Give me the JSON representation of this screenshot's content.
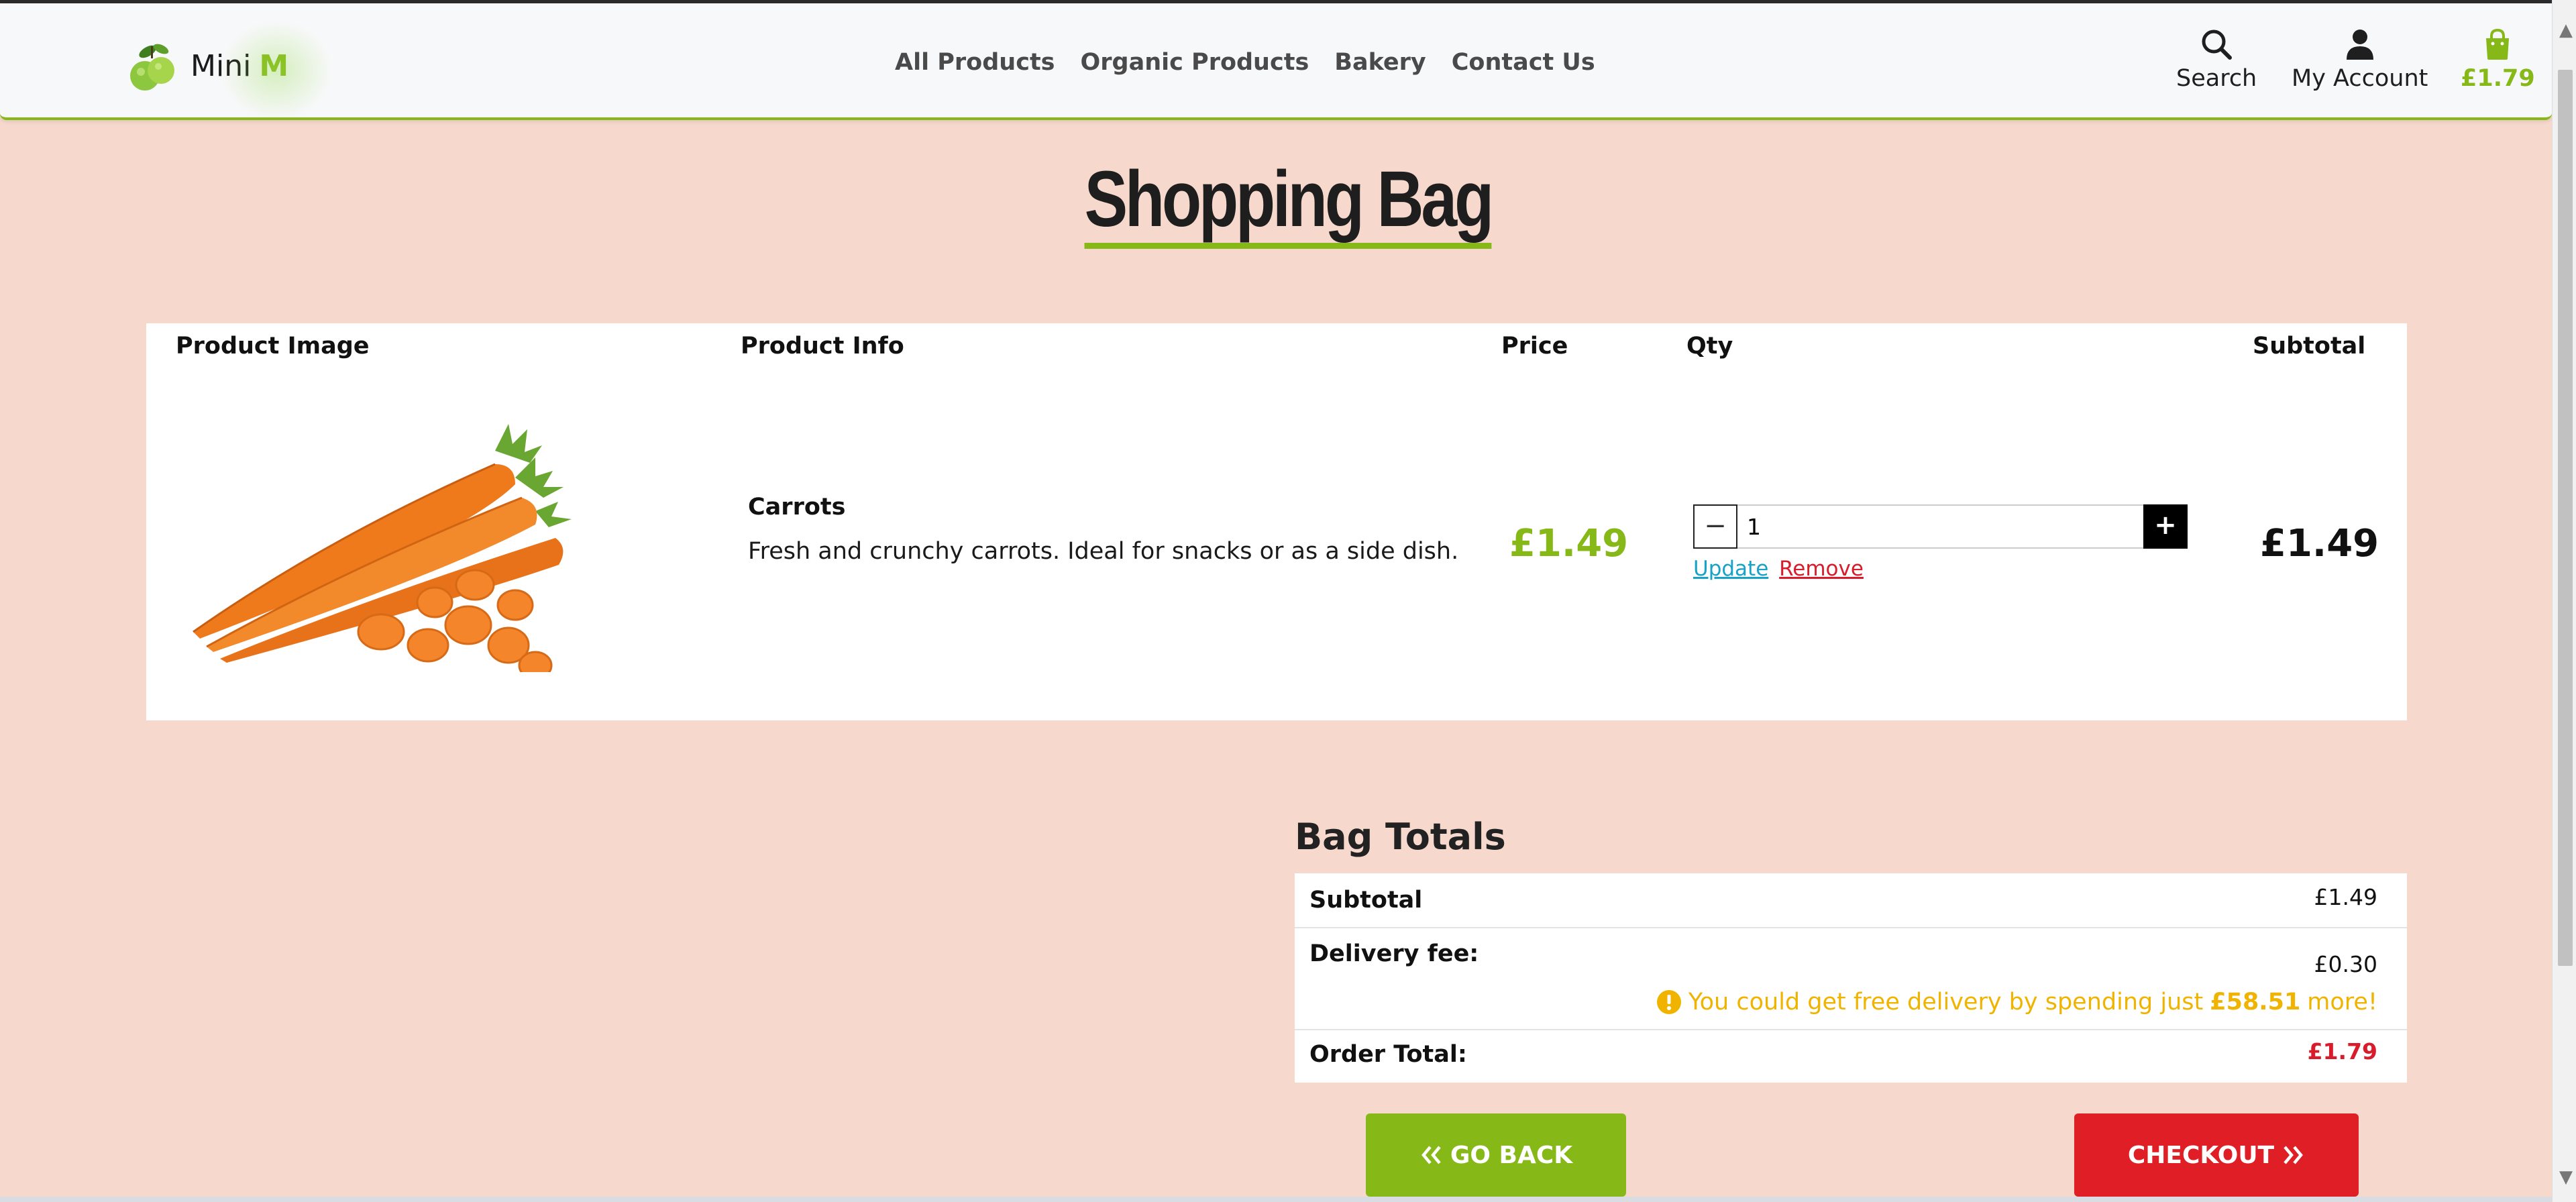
{
  "header": {
    "logo_text": "Mini",
    "logo_accent": "M",
    "nav": [
      "All Products",
      "Organic Products",
      "Bakery",
      "Contact Us"
    ],
    "search_label": "Search",
    "account_label": "My Account",
    "cart_total": "£1.79",
    "icons": {
      "search": "search-icon",
      "account": "user-icon",
      "cart": "shopping-bag-icon"
    }
  },
  "page": {
    "title": "Shopping Bag"
  },
  "table": {
    "headers": [
      "Product Image",
      "Product Info",
      "Price",
      "Qty",
      "Subtotal"
    ],
    "item": {
      "name": "Carrots",
      "description": "Fresh and crunchy carrots. Ideal for snacks or as a side dish.",
      "price": "£1.49",
      "qty": "1",
      "qty_minus": "−",
      "qty_plus": "+",
      "update_label": "Update",
      "remove_label": "Remove",
      "subtotal": "£1.49"
    }
  },
  "totals": {
    "title": "Bag Totals",
    "subtotal_label": "Subtotal",
    "subtotal_value": "£1.49",
    "delivery_label": "Delivery fee:",
    "delivery_value": "£0.30",
    "notice_prefix": "You could get free delivery by spending just",
    "notice_amount": "£58.51",
    "notice_suffix": "more!",
    "order_total_label": "Order Total:",
    "order_total_value": "£1.79"
  },
  "buttons": {
    "back": "GO BACK",
    "checkout": "CHECKOUT"
  },
  "colors": {
    "accent": "#86b817",
    "danger": "#e01e25",
    "background": "#f6d8cc",
    "warning": "#f0b400",
    "link": "#17a2c8"
  }
}
